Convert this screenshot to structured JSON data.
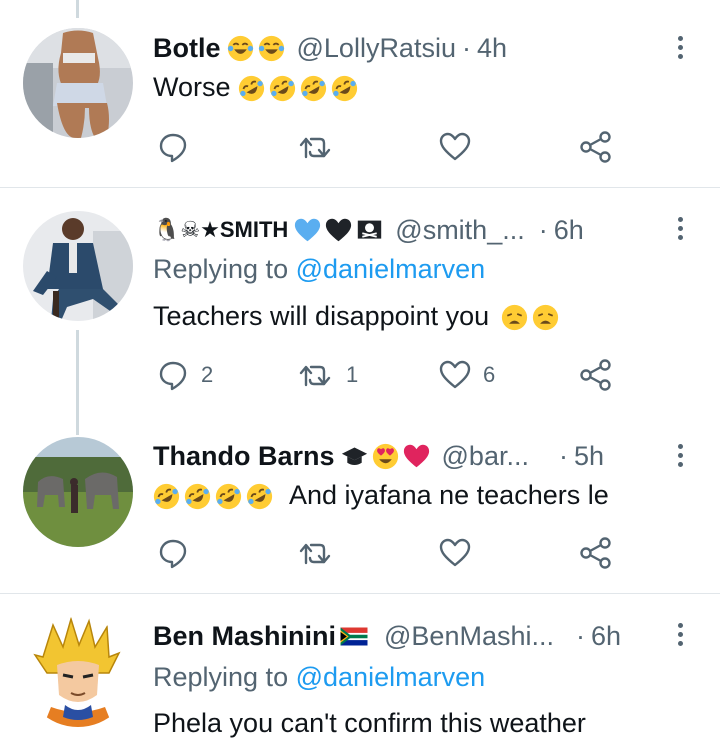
{
  "tweets": [
    {
      "name": "Botle",
      "name_emojis": [
        "joy",
        "joy"
      ],
      "handle": "@LollyRatsiu",
      "time": "4h",
      "replying_label": "",
      "replying_handle": "",
      "text": "Worse",
      "text_emojis_after": [
        "rofl",
        "rofl",
        "rofl",
        "rofl"
      ],
      "counts": {
        "reply": "",
        "retweet": "",
        "like": ""
      }
    },
    {
      "name": "🐧☠★SΜITH",
      "name_emojis": [
        "blue-heart",
        "black-heart",
        "pirate-flag"
      ],
      "handle": "@smith_...",
      "time": "6h",
      "replying_label": "Replying to",
      "replying_handle": "@danielmarven",
      "text": "Teachers will disappoint you",
      "text_emojis_after": [
        "weary",
        "weary"
      ],
      "counts": {
        "reply": "2",
        "retweet": "1",
        "like": "6"
      }
    },
    {
      "name": "Thando Barns",
      "name_emojis": [
        "graduation-cap",
        "heart-eyes",
        "red-heart"
      ],
      "handle": "@bar...",
      "time": "5h",
      "replying_label": "",
      "replying_handle": "",
      "text_emojis_before": [
        "rofl",
        "rofl",
        "rofl",
        "rofl"
      ],
      "text": "And iyafana ne teachers le",
      "counts": {
        "reply": "",
        "retweet": "",
        "like": ""
      }
    },
    {
      "name": "Ben Mashinini",
      "name_emojis": [
        "flag-za"
      ],
      "handle": "@BenMashi...",
      "time": "6h",
      "replying_label": "Replying to",
      "replying_handle": "@danielmarven",
      "text": "Phela you can't confirm this weather",
      "counts": {
        "reply": "",
        "retweet": "",
        "like": ""
      }
    }
  ],
  "colors": {
    "text": "#0f1419",
    "muted": "#536471",
    "link": "#1d9bf0",
    "divider": "#e1e6ea"
  }
}
